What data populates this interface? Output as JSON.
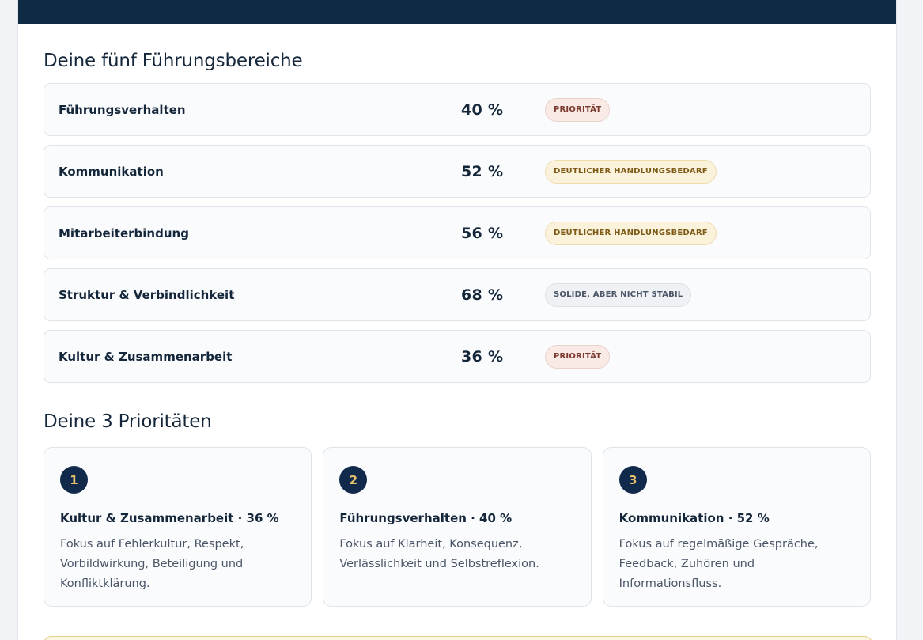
{
  "areas_section": {
    "title": "Deine fünf Führungsbereiche",
    "rows": [
      {
        "name": "Führungsverhalten",
        "score": "40 %",
        "badge": "PRIORITÄT",
        "badge_type": "prio"
      },
      {
        "name": "Kommunikation",
        "score": "52 %",
        "badge": "DEUTLICHER HANDLUNGSBEDARF",
        "badge_type": "deut"
      },
      {
        "name": "Mitarbeiterbindung",
        "score": "56 %",
        "badge": "DEUTLICHER HANDLUNGSBEDARF",
        "badge_type": "deut"
      },
      {
        "name": "Struktur & Verbindlichkeit",
        "score": "68 %",
        "badge": "SOLIDE, ABER NICHT STABIL",
        "badge_type": "sol"
      },
      {
        "name": "Kultur & Zusammenarbeit",
        "score": "36 %",
        "badge": "PRIORITÄT",
        "badge_type": "prio"
      }
    ]
  },
  "priorities_section": {
    "title": "Deine 3 Prioritäten",
    "cards": [
      {
        "number": "1",
        "heading": "Kultur & Zusammenarbeit · 36 %",
        "text": "Fokus auf Fehlerkultur, Respekt, Vorbildwirkung, Beteiligung und Konfliktklärung."
      },
      {
        "number": "2",
        "heading": "Führungsverhalten · 40 %",
        "text": "Fokus auf Klarheit, Konsequenz, Verlässlichkeit und Selbstreflexion."
      },
      {
        "number": "3",
        "heading": "Kommunikation · 52 %",
        "text": "Fokus auf regelmäßige Gespräche, Feedback, Zuhören und Informationsfluss."
      }
    ]
  },
  "colors": {
    "header": "#0f2a45",
    "badge_prio": "#faeae6",
    "badge_deut": "#fbf2dc",
    "badge_sol": "#eff1f4",
    "number_circle": "#11294a",
    "number_text": "#e7c26a"
  }
}
